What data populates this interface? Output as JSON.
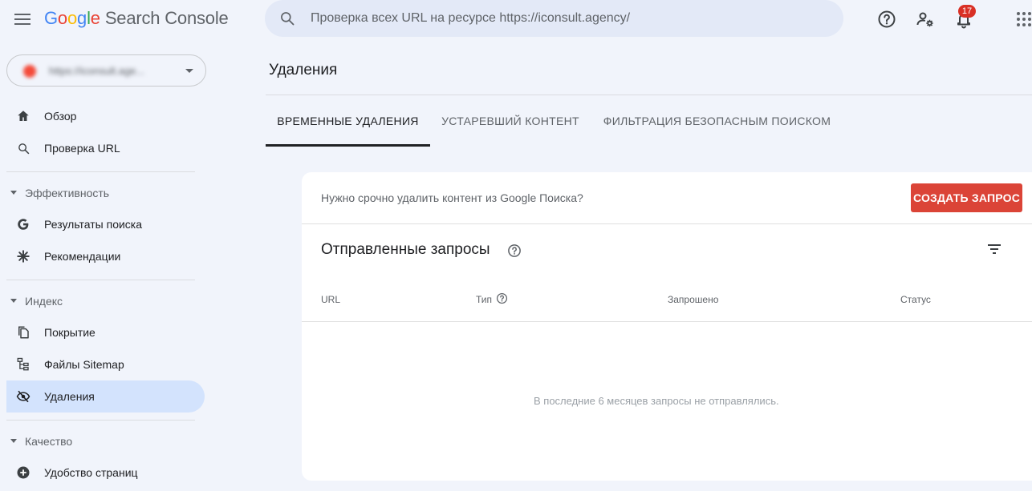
{
  "header": {
    "logo": {
      "g1": "G",
      "g2": "o",
      "g3": "o",
      "g4": "g",
      "g5": "l",
      "g6": "e",
      "product": "Search Console"
    },
    "search_placeholder": "Проверка всех URL на ресурсе https://iconsult.agency/",
    "notification_count": "17"
  },
  "sidebar": {
    "property_label": "https://iconsult.age...",
    "items": [
      {
        "label": "Обзор",
        "icon": "home-icon"
      },
      {
        "label": "Проверка URL",
        "icon": "search-icon"
      }
    ],
    "sections": [
      {
        "label": "Эффективность",
        "items": [
          {
            "label": "Результаты поиска",
            "icon": "google-g-icon"
          },
          {
            "label": "Рекомендации",
            "icon": "sparkle-icon"
          }
        ]
      },
      {
        "label": "Индекс",
        "items": [
          {
            "label": "Покрытие",
            "icon": "pages-icon"
          },
          {
            "label": "Файлы Sitemap",
            "icon": "sitemap-icon"
          },
          {
            "label": "Удаления",
            "icon": "eye-off-icon",
            "active": true
          }
        ]
      },
      {
        "label": "Качество",
        "items": [
          {
            "label": "Удобство страниц",
            "icon": "plus-circle-icon"
          }
        ]
      }
    ]
  },
  "main": {
    "title": "Удаления",
    "tabs": [
      {
        "label": "ВРЕМЕННЫЕ УДАЛЕНИЯ",
        "active": true
      },
      {
        "label": "УСТАРЕВШИЙ КОНТЕНТ"
      },
      {
        "label": "ФИЛЬТРАЦИЯ БЕЗОПАСНЫМ ПОИСКОМ"
      }
    ],
    "card": {
      "cta_text": "Нужно срочно удалить контент из Google Поиска?",
      "cta_button": "СОЗДАТЬ ЗАПРОС",
      "section_title": "Отправленные запросы",
      "columns": [
        "URL",
        "Тип",
        "Запрошено",
        "Статус"
      ],
      "empty_text": "В последние 6 месяцев запросы не отправлялись."
    }
  },
  "colors": {
    "background": "#f1f4fb",
    "search_bg": "#e3e9f7",
    "active_nav": "#d3e3fd",
    "cta_red": "#db4437",
    "badge_red": "#d93025"
  }
}
